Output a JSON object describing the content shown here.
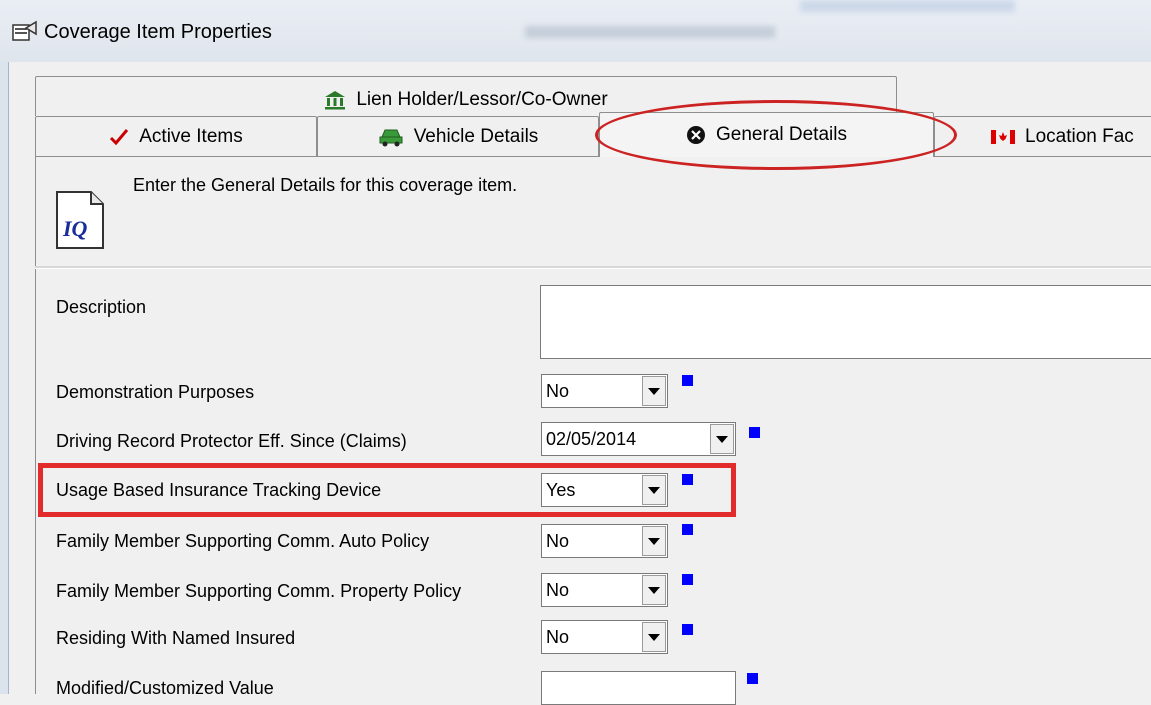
{
  "window": {
    "title": "Coverage Item Properties",
    "icon": "properties-icon"
  },
  "tabs": {
    "row_back": [
      {
        "label": "Lien Holder/Lessor/Co-Owner",
        "icon": "bank-icon"
      }
    ],
    "row_front": [
      {
        "label": "Active Items",
        "icon": "checkmark-icon",
        "color": "#cc0000"
      },
      {
        "label": "Vehicle Details",
        "icon": "car-icon",
        "color": "#2a8a2a"
      },
      {
        "label": "General Details",
        "icon": "general-details-icon",
        "selected": true
      },
      {
        "label": "Location Fac",
        "icon": "canada-flag-icon",
        "color": "#dd0000"
      }
    ]
  },
  "panel": {
    "intro": "Enter the General Details for this coverage item.",
    "icon_text": "IQ"
  },
  "fields": [
    {
      "label": "Description",
      "value": ""
    },
    {
      "label": "Demonstration Purposes",
      "value": "No"
    },
    {
      "label": "Driving Record Protector Eff. Since (Claims)",
      "value": "02/05/2014"
    },
    {
      "label": "Usage Based Insurance Tracking Device",
      "value": "Yes",
      "highlighted": true
    },
    {
      "label": "Family Member Supporting Comm. Auto Policy",
      "value": "No"
    },
    {
      "label": "Family Member Supporting Comm. Property Policy",
      "value": "No"
    },
    {
      "label": "Residing With Named Insured",
      "value": "No"
    },
    {
      "label": "Modified/Customized Value",
      "value": ""
    }
  ],
  "colors": {
    "required_marker": "#0000ff",
    "annotation": "#e22c2c"
  }
}
